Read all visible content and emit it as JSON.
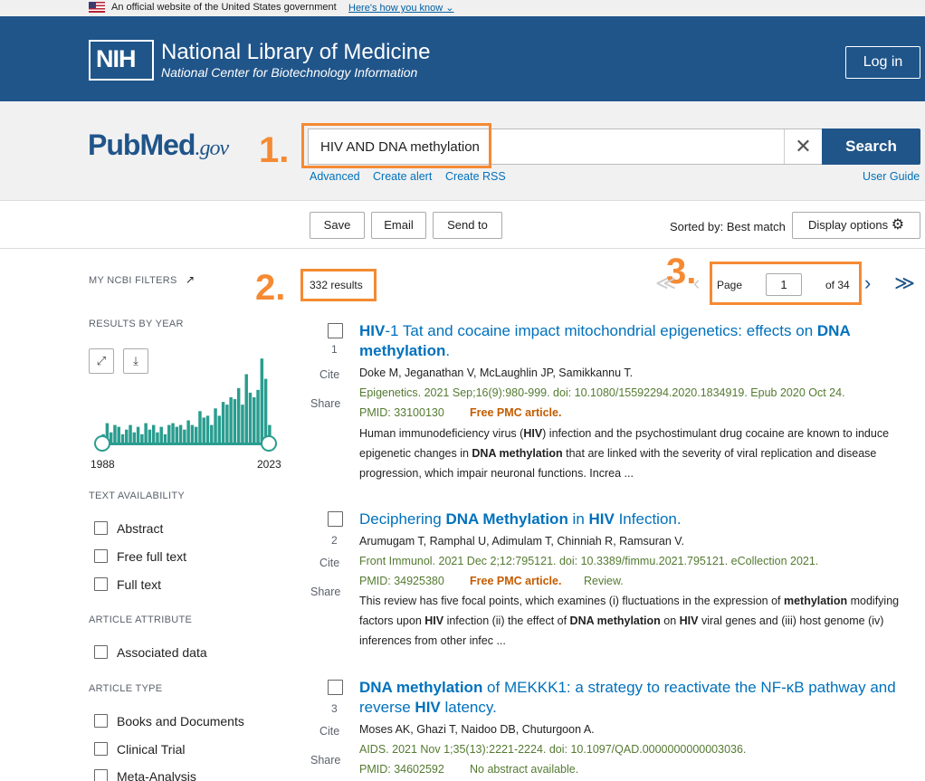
{
  "gov_banner": {
    "text": "An official website of the United States government",
    "link": "Here's how you know"
  },
  "header": {
    "org": "National Library of Medicine",
    "sub": "National Center for Biotechnology Information",
    "logo": "NIH",
    "login": "Log in"
  },
  "search": {
    "brand_a": "Pub",
    "brand_b": "Med",
    "brand_c": ".gov",
    "query": "HIV AND DNA methylation",
    "button": "Search",
    "links": [
      "Advanced",
      "Create alert",
      "Create RSS"
    ],
    "user_guide": "User Guide"
  },
  "annotations": [
    "1.",
    "2.",
    "3."
  ],
  "toolbar": {
    "save": "Save",
    "email": "Email",
    "send": "Send to",
    "sorted": "Sorted by: Best match",
    "display": "Display options"
  },
  "sidebar": {
    "my_ncbi": "MY NCBI FILTERS",
    "by_year": "RESULTS BY YEAR",
    "year_start": "1988",
    "year_end": "2023",
    "text_avail": "TEXT AVAILABILITY",
    "text_opts": [
      "Abstract",
      "Free full text",
      "Full text"
    ],
    "art_attr": "ARTICLE ATTRIBUTE",
    "attr_opts": [
      "Associated data"
    ],
    "art_type": "ARTICLE TYPE",
    "type_opts": [
      "Books and Documents",
      "Clinical Trial",
      "Meta-Analysis"
    ],
    "histogram": [
      0.1,
      0.22,
      0.12,
      0.2,
      0.18,
      0.1,
      0.15,
      0.2,
      0.12,
      0.18,
      0.1,
      0.22,
      0.15,
      0.2,
      0.12,
      0.18,
      0.1,
      0.2,
      0.22,
      0.18,
      0.2,
      0.15,
      0.25,
      0.2,
      0.18,
      0.35,
      0.28,
      0.3,
      0.2,
      0.38,
      0.3,
      0.45,
      0.42,
      0.5,
      0.48,
      0.6,
      0.42,
      0.75,
      0.55,
      0.5,
      0.58,
      0.92,
      0.7,
      0.2
    ]
  },
  "results": {
    "count": "332 results",
    "page_label": "Page",
    "page": "1",
    "of": "of 34",
    "cite": "Cite",
    "share": "Share",
    "free_pmc": "Free PMC article.",
    "articles": [
      {
        "num": "1",
        "t1": "HIV",
        "t2": "-1 Tat and cocaine impact mitochondrial epigenetics: effects on ",
        "t3": "DNA methylation",
        "t4": ".",
        "authors": "Doke M, Jeganathan V, McLaughlin JP, Samikkannu T.",
        "journal": "Epigenetics. 2021 Sep;16(9):980-999. doi: 10.1080/15592294.2020.1834919. Epub 2020 Oct 24.",
        "pmid": "PMID: 33100130",
        "s1": "Human immunodeficiency virus (",
        "s2": "HIV",
        "s3": ") infection and the psychostimulant drug cocaine are known to induce epigenetic changes in ",
        "s4": "DNA methylation",
        "s5": " that are linked with the severity of viral replication and disease progression, which impair neuronal functions. Increa ..."
      },
      {
        "num": "2",
        "t1": "Deciphering ",
        "t2": "DNA Methylation",
        "t3": " in ",
        "t4": "HIV",
        "t5": " Infection.",
        "authors": "Arumugam T, Ramphal U, Adimulam T, Chinniah R, Ramsuran V.",
        "journal": "Front Immunol. 2021 Dec 2;12:795121. doi: 10.3389/fimmu.2021.795121. eCollection 2021.",
        "pmid": "PMID: 34925380",
        "review": "Review.",
        "s1": "This review has five focal points, which examines (i) fluctuations in the expression of ",
        "s2": "methylation",
        "s3": " modifying factors upon ",
        "s4": "HIV",
        "s5": " infection (ii) the effect of ",
        "s6": "DNA methylation",
        "s7": " on ",
        "s8": "HIV",
        "s9": " viral genes and (iii) host genome (iv) inferences from other infec ..."
      },
      {
        "num": "3",
        "t1": "DNA methylation",
        "t2": " of MEKKK1: a strategy to reactivate the NF-κB pathway and reverse ",
        "t3": "HIV",
        "t4": " latency.",
        "authors": "Moses AK, Ghazi T, Naidoo DB, Chuturgoon A.",
        "journal": "AIDS. 2021 Nov 1;35(13):2221-2224. doi: 10.1097/QAD.0000000000003036.",
        "pmid": "PMID: 34602592",
        "no_abstract": "No abstract available."
      }
    ]
  }
}
